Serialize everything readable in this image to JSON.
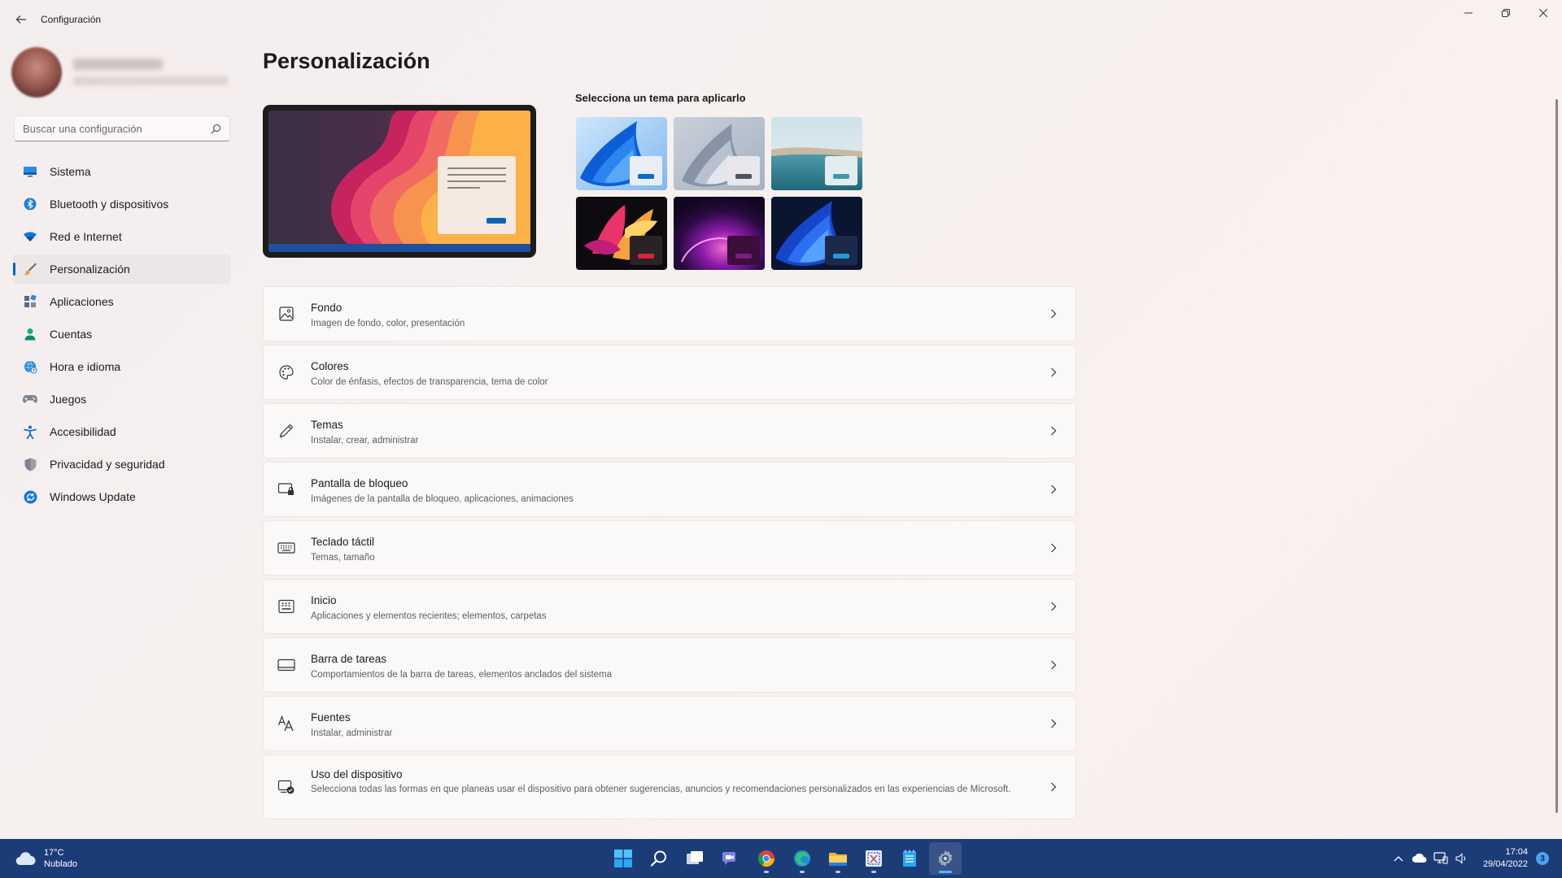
{
  "window": {
    "title": "Configuración",
    "controls": [
      "minimize-icon",
      "restore-icon",
      "close-icon"
    ]
  },
  "sidebar": {
    "search": {
      "placeholder": "Buscar una configuración"
    },
    "items": [
      {
        "label": "Sistema",
        "icon": "monitor-icon",
        "color": "#0a7ad6"
      },
      {
        "label": "Bluetooth y dispositivos",
        "icon": "bluetooth-icon",
        "color": "#0f7bdc"
      },
      {
        "label": "Red e Internet",
        "icon": "wifi-icon",
        "color": "#0a66c2"
      },
      {
        "label": "Personalización",
        "icon": "brush-icon",
        "color": "#e08a2e",
        "active": true
      },
      {
        "label": "Aplicaciones",
        "icon": "apps-icon",
        "color": "#5b6b84"
      },
      {
        "label": "Cuentas",
        "icon": "person-icon",
        "color": "#1ba58a"
      },
      {
        "label": "Hora e idioma",
        "icon": "globe-clock-icon",
        "color": "#1e86d6"
      },
      {
        "label": "Juegos",
        "icon": "gamepad-icon",
        "color": "#7a7f89"
      },
      {
        "label": "Accesibilidad",
        "icon": "accessibility-icon",
        "color": "#1170d0"
      },
      {
        "label": "Privacidad y seguridad",
        "icon": "shield-icon",
        "color": "#7d8088"
      },
      {
        "label": "Windows Update",
        "icon": "update-icon",
        "color": "#1479d3"
      }
    ]
  },
  "main": {
    "title": "Personalización",
    "themes_label": "Selecciona un tema para aplicarlo",
    "themes": [
      {
        "name": "windows-light-bloom",
        "bar": "#0b6cc6",
        "mini": "#e9eef6"
      },
      {
        "name": "windows-light-glow",
        "bar": "#4a5561",
        "mini": "#e8e8ec"
      },
      {
        "name": "captured-motion",
        "bar": "#3a9bb0",
        "mini": "#e3ecee"
      },
      {
        "name": "flow",
        "bar": "#d6262f",
        "mini": "#2a2326"
      },
      {
        "name": "sunrise",
        "bar": "#7b1d7f",
        "mini": "#3b0e3c"
      },
      {
        "name": "windows-dark-bloom",
        "bar": "#1f9be0",
        "mini": "#1b2a4a"
      }
    ],
    "cards": [
      {
        "title": "Fondo",
        "desc": "Imagen de fondo, color, presentación",
        "icon": "image-icon"
      },
      {
        "title": "Colores",
        "desc": "Color de énfasis, efectos de transparencia, tema de color",
        "icon": "palette-icon"
      },
      {
        "title": "Temas",
        "desc": "Instalar, crear, administrar",
        "icon": "pen-icon"
      },
      {
        "title": "Pantalla de bloqueo",
        "desc": "Imágenes de la pantalla de bloqueo, aplicaciones, animaciones",
        "icon": "lock-screen-icon"
      },
      {
        "title": "Teclado táctil",
        "desc": "Temas, tamaño",
        "icon": "keyboard-icon"
      },
      {
        "title": "Inicio",
        "desc": "Aplicaciones y elementos recientes; elementos, carpetas",
        "icon": "start-menu-icon"
      },
      {
        "title": "Barra de tareas",
        "desc": "Comportamientos de la barra de tareas, elementos anclados del sistema",
        "icon": "taskbar-icon"
      },
      {
        "title": "Fuentes",
        "desc": "Instalar, administrar",
        "icon": "font-icon"
      },
      {
        "title": "Uso del dispositivo",
        "desc": "Selecciona todas las formas en que planeas usar el dispositivo para obtener sugerencias, anuncios y recomendaciones personalizados en las experiencias de Microsoft.",
        "icon": "device-usage-icon"
      }
    ]
  },
  "taskbar": {
    "weather": {
      "temp": "17°C",
      "condition": "Nublado"
    },
    "apps": [
      {
        "name": "start-icon"
      },
      {
        "name": "search-icon"
      },
      {
        "name": "task-view-icon"
      },
      {
        "name": "teams-chat-icon"
      },
      {
        "name": "chrome-icon"
      },
      {
        "name": "edge-icon"
      },
      {
        "name": "file-explorer-icon"
      },
      {
        "name": "snipping-tool-icon"
      },
      {
        "name": "notepad-icon"
      },
      {
        "name": "settings-icon",
        "active": true
      }
    ],
    "time": "17:04",
    "date": "29/04/2022",
    "notifications": "3"
  }
}
